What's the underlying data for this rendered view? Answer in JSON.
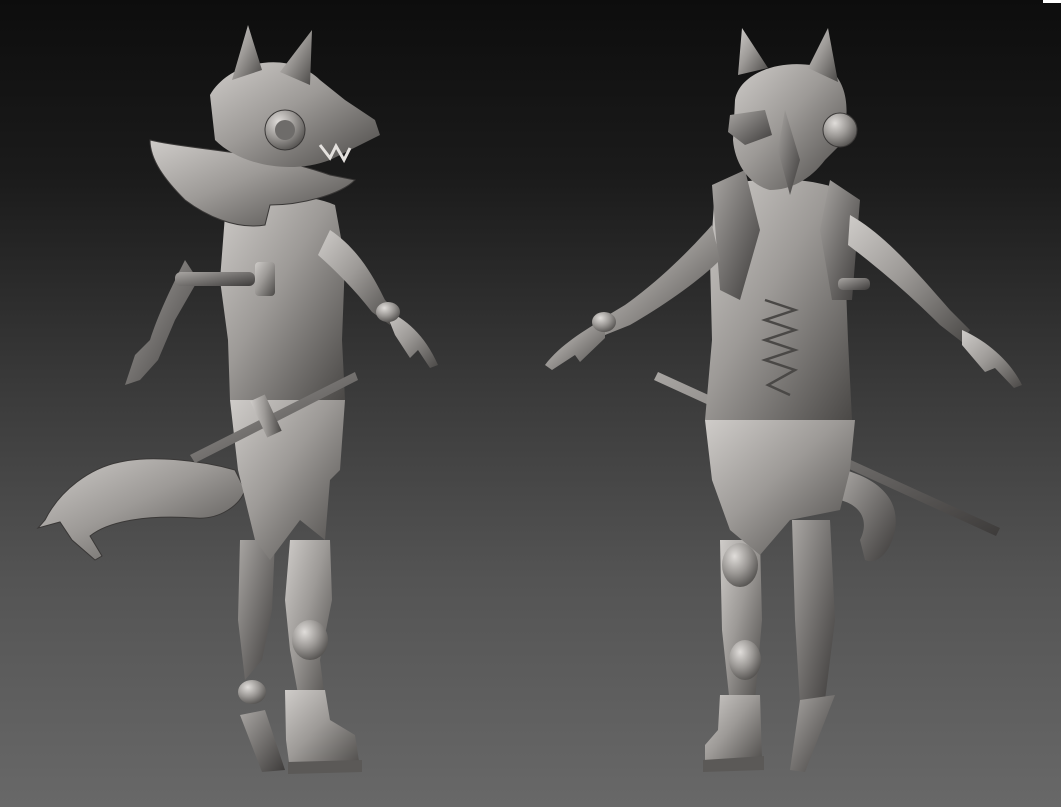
{
  "scene": {
    "background_top": "#0d0d0d",
    "background_bottom": "#686868",
    "clay_color": "#8f8c8a",
    "clay_highlight": "#d6d3d0",
    "clay_shadow": "#3f3d3c"
  },
  "figures": [
    {
      "view": "back-three-quarter"
    },
    {
      "view": "front"
    }
  ]
}
